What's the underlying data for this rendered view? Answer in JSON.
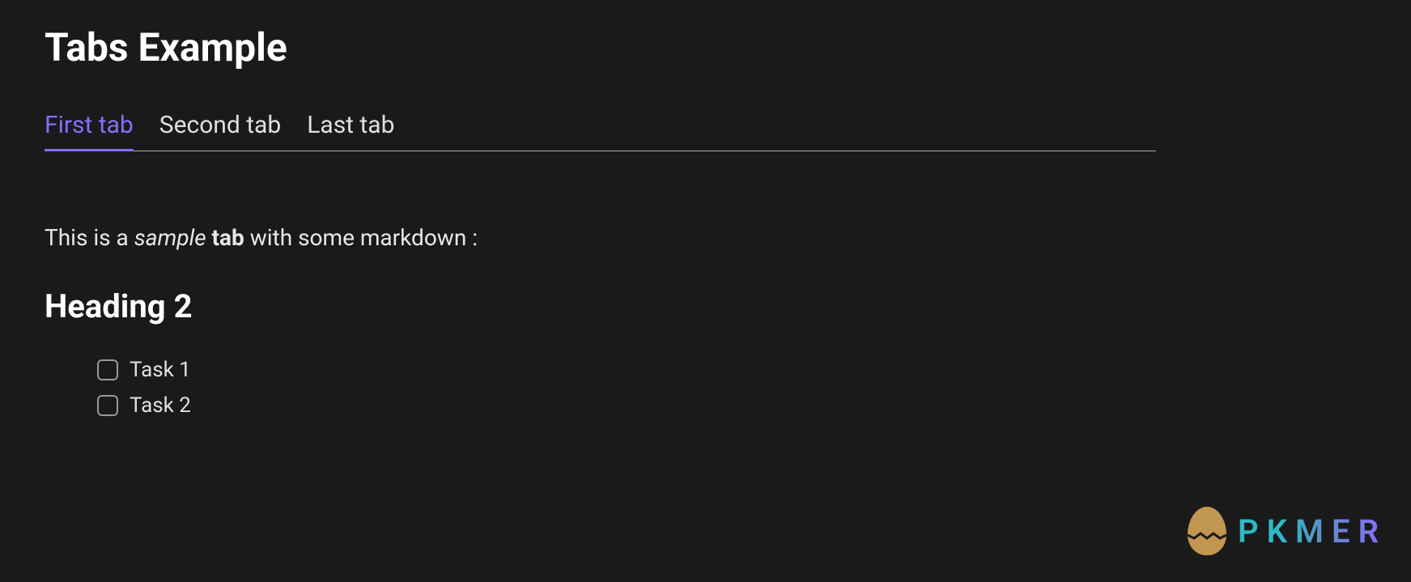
{
  "page": {
    "title": "Tabs Example"
  },
  "tabs": [
    {
      "label": "First tab",
      "active": true
    },
    {
      "label": "Second tab",
      "active": false
    },
    {
      "label": "Last tab",
      "active": false
    }
  ],
  "content": {
    "intro": {
      "prefix": "This is a ",
      "italic": "sample",
      "space": " ",
      "bold": "tab",
      "suffix": " with some markdown :"
    },
    "heading": "Heading 2",
    "tasks": [
      {
        "label": "Task 1",
        "checked": false
      },
      {
        "label": "Task 2",
        "checked": false
      }
    ]
  },
  "watermark": {
    "brand": "PKMER"
  },
  "colors": {
    "accent": "#8a6dff",
    "background": "#1a1a1a",
    "text": "#e0e0e0"
  }
}
